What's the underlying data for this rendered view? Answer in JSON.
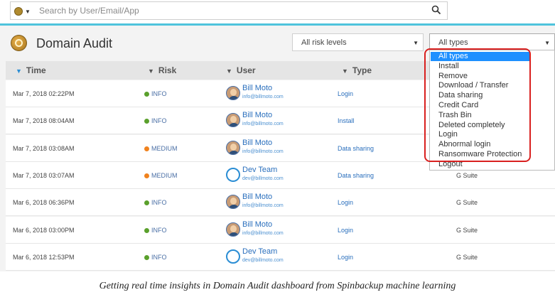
{
  "search": {
    "placeholder": "Search by User/Email/App"
  },
  "header": {
    "title": "Domain Audit",
    "risk_select": "All risk levels",
    "type_select": "All types"
  },
  "columns": {
    "time": "Time",
    "risk": "Risk",
    "user": "User",
    "type": "Type"
  },
  "rows": [
    {
      "time": "Mar 7, 2018 02:22PM",
      "risk": "INFO",
      "risk_color": "#5aa02c",
      "user": "Bill Moto",
      "email": "info@billmoto.com",
      "avatar": "person",
      "type": "Login",
      "app": ""
    },
    {
      "time": "Mar 7, 2018 08:04AM",
      "risk": "INFO",
      "risk_color": "#5aa02c",
      "user": "Bill Moto",
      "email": "info@billmoto.com",
      "avatar": "person",
      "type": "Install",
      "app": ""
    },
    {
      "time": "Mar 7, 2018 03:08AM",
      "risk": "MEDIUM",
      "risk_color": "#f0821e",
      "user": "Bill Moto",
      "email": "info@billmoto.com",
      "avatar": "person",
      "type": "Data sharing",
      "app": ""
    },
    {
      "time": "Mar 7, 2018 03:07AM",
      "risk": "MEDIUM",
      "risk_color": "#f0821e",
      "user": "Dev Team",
      "email": "dev@billmoto.com",
      "avatar": "team",
      "type": "Data sharing",
      "app": "G Suite"
    },
    {
      "time": "Mar 6, 2018 06:36PM",
      "risk": "INFO",
      "risk_color": "#5aa02c",
      "user": "Bill Moto",
      "email": "info@billmoto.com",
      "avatar": "person",
      "type": "Login",
      "app": "G Suite"
    },
    {
      "time": "Mar 6, 2018 03:00PM",
      "risk": "INFO",
      "risk_color": "#5aa02c",
      "user": "Bill Moto",
      "email": "info@billmoto.com",
      "avatar": "person",
      "type": "Login",
      "app": "G Suite"
    },
    {
      "time": "Mar 6, 2018 12:53PM",
      "risk": "INFO",
      "risk_color": "#5aa02c",
      "user": "Dev Team",
      "email": "dev@billmoto.com",
      "avatar": "team",
      "type": "Login",
      "app": "G Suite"
    }
  ],
  "dropdown": {
    "options": [
      "All types",
      "Install",
      "Remove",
      "Download / Transfer",
      "Data sharing",
      "Credit Card",
      "Trash Bin",
      "Deleted completely",
      "Login",
      "Abnormal login",
      "Ransomware Protection",
      "Logout"
    ],
    "selected_index": 0
  },
  "caption": "Getting real time insights in Domain Audit dashboard from Spinbackup machine learning"
}
